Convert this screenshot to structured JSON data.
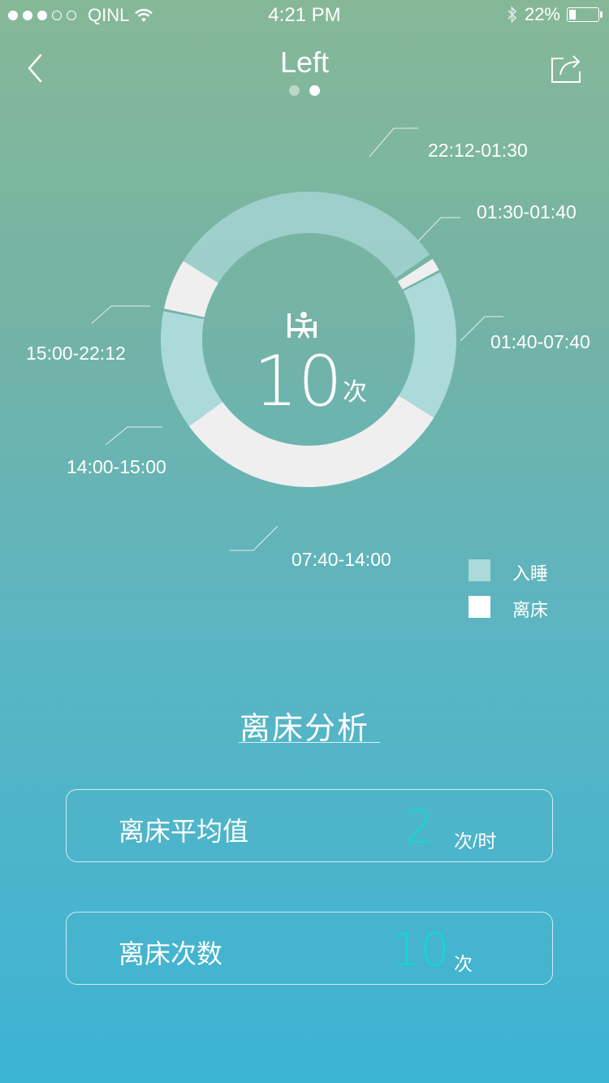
{
  "status_bar": {
    "carrier": "QINL",
    "time": "4:21 PM",
    "battery": "22%",
    "signal_filled": 3,
    "signal_total": 5,
    "battery_level": 0.22
  },
  "header": {
    "title": "Left",
    "pager": {
      "count": 2,
      "active": 1
    },
    "back_icon": "chevron-left-icon",
    "share_icon": "share-icon"
  },
  "donut": {
    "center_value": "10",
    "center_unit": "次",
    "center_icon": "out-of-bed-icon",
    "segments": [
      {
        "label": "22:12-01:30",
        "status": "入睡"
      },
      {
        "label": "01:30-01:40",
        "status": "离床"
      },
      {
        "label": "01:40-07:40",
        "status": "入睡"
      },
      {
        "label": "07:40-14:00",
        "status": "离床"
      },
      {
        "label": "14:00-15:00",
        "status": "入睡"
      },
      {
        "label": "15:00-22:12",
        "status": "离床"
      }
    ]
  },
  "legend": [
    {
      "label": "入睡",
      "color": "#acd9da"
    },
    {
      "label": "离床",
      "color": "#ffffff"
    }
  ],
  "analysis": {
    "title": "离床分析",
    "cards": [
      {
        "label": "离床平均值",
        "value": "2",
        "unit": "次/时"
      },
      {
        "label": "离床次数",
        "value": "10",
        "unit": "次"
      }
    ]
  },
  "colors": {
    "sleep": "#acd9da",
    "leave_bed": "#efefef",
    "accent": "#18d5cf"
  }
}
